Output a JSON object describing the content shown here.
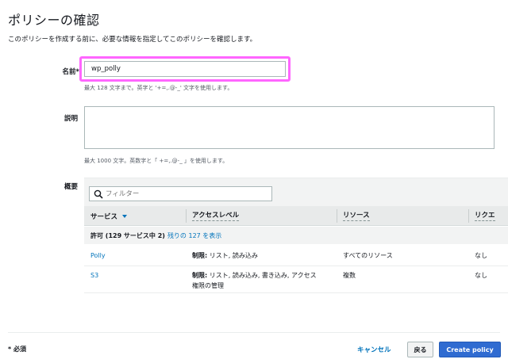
{
  "page": {
    "title": "ポリシーの確認",
    "description": "このポリシーを作成する前に、必要な情報を指定してこのポリシーを確認します。"
  },
  "form": {
    "name_label": "名前*",
    "name_value": "wp_polly",
    "name_hint": "最大 128 文字まで。英字と '+=,.@-_' 文字を使用します。",
    "description_label": "説明",
    "description_value": "",
    "description_hint": "最大 1000 文字。英数字と「 +=,.@-_ 」を使用します。",
    "summary_label": "概要"
  },
  "summary": {
    "filter_placeholder": "フィルター",
    "columns": [
      "サービス",
      "アクセスレベル",
      "リソース",
      "リクエ"
    ],
    "group": {
      "bold": "許可 (129 サービス中 2)",
      "link": "残りの 127 を表示"
    },
    "rows": [
      {
        "service": "Polly",
        "access_bold": "制限:",
        "access_text": "リスト, 読み込み",
        "access_text2": "",
        "resource": "すべてのリソース",
        "request": "なし"
      },
      {
        "service": "S3",
        "access_bold": "制限:",
        "access_text": "リスト, 読み込み, 書き込み, アクセス",
        "access_text2": "権限の管理",
        "resource": "複数",
        "request": "なし"
      }
    ]
  },
  "footer": {
    "required_note": "* 必須",
    "cancel_label": "キャンセル",
    "back_label": "戻る",
    "create_label": "Create policy"
  },
  "colors": {
    "highlight": "#ff66ff",
    "link": "#0073bb",
    "primary_button": "#2f6bd1"
  }
}
